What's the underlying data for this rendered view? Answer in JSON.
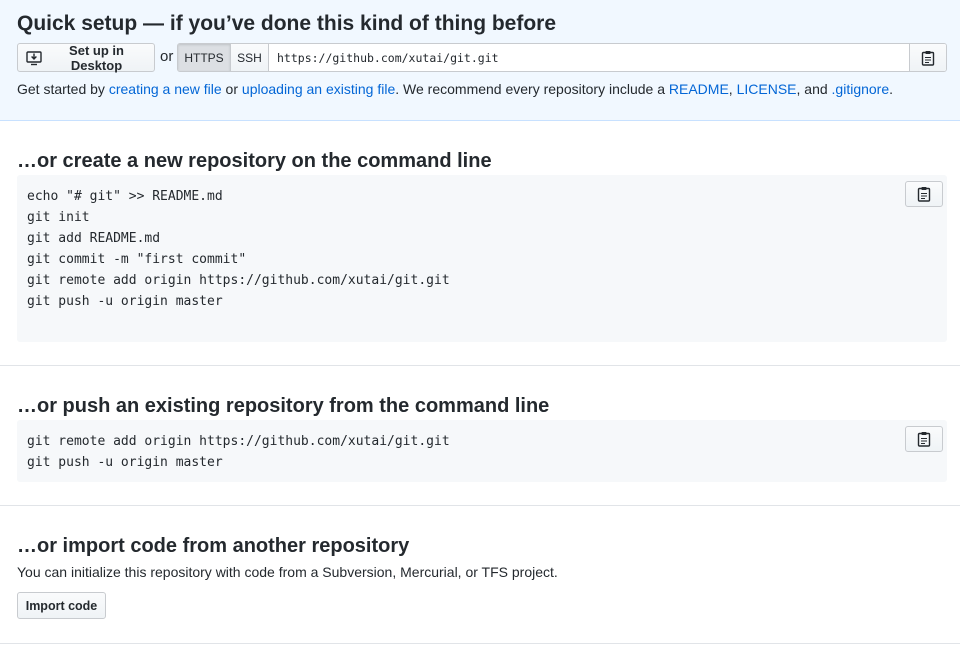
{
  "quick_setup": {
    "title": "Quick setup — if you’ve done this kind of thing before",
    "desktop_button": "Set up in Desktop",
    "or": "or",
    "protocols": {
      "https": "HTTPS",
      "ssh": "SSH",
      "selected": "HTTPS"
    },
    "clone_url": "https://github.com/xutai/git.git",
    "description": {
      "part1": "Get started by ",
      "link_create": "creating a new file",
      "part2": " or ",
      "link_upload": "uploading an existing file",
      "part3": ". We recommend every repository include a ",
      "link_readme": "README",
      "sep1": ", ",
      "link_license": "LICENSE",
      "part4": ", and ",
      "link_gitignore": ".gitignore",
      "part5": "."
    }
  },
  "create_section": {
    "title": "…or create a new repository on the command line",
    "code": "echo \"# git\" >> README.md\ngit init\ngit add README.md\ngit commit -m \"first commit\"\ngit remote add origin https://github.com/xutai/git.git\ngit push -u origin master"
  },
  "push_section": {
    "title": "…or push an existing repository from the command line",
    "code": "git remote add origin https://github.com/xutai/git.git\ngit push -u origin master"
  },
  "import_section": {
    "title": "…or import code from another repository",
    "description": "You can initialize this repository with code from a Subversion, Mercurial, or TFS project.",
    "button": "Import code"
  },
  "icons": {
    "desktop": "desktop-download-icon",
    "clipboard": "clipboard-icon"
  }
}
